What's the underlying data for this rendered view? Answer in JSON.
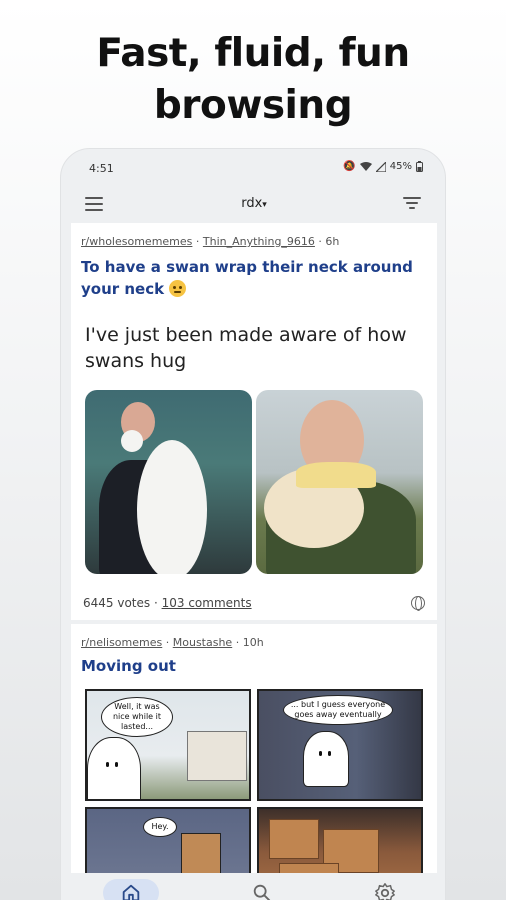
{
  "headline": {
    "line1": "Fast, fluid, fun",
    "line2": "browsing"
  },
  "status_bar": {
    "time": "4:51",
    "battery": "45%"
  },
  "app_bar": {
    "title": "rdx",
    "title_caret": "▾"
  },
  "posts": [
    {
      "subreddit": "r/wholesomememes",
      "author": "Thin_Anything_9616",
      "age": "6h",
      "title": "To have a swan wrap their neck around your neck",
      "caption": "I've just been made aware of how swans hug",
      "votes": "6445 votes",
      "comments": "103 comments"
    },
    {
      "subreddit": "r/nelisomemes",
      "author": "Moustashe",
      "age": "10h",
      "title": "Moving out",
      "comic_text": [
        "Well, it was nice while it lasted...",
        "... but I guess everyone goes away eventually",
        "Hey."
      ]
    }
  ],
  "bottom_nav": {
    "icons": [
      "home-icon",
      "search-icon",
      "settings-icon"
    ]
  },
  "colors": {
    "title_link": "#1f3f8a",
    "nav_active": "#d7e1f3"
  }
}
